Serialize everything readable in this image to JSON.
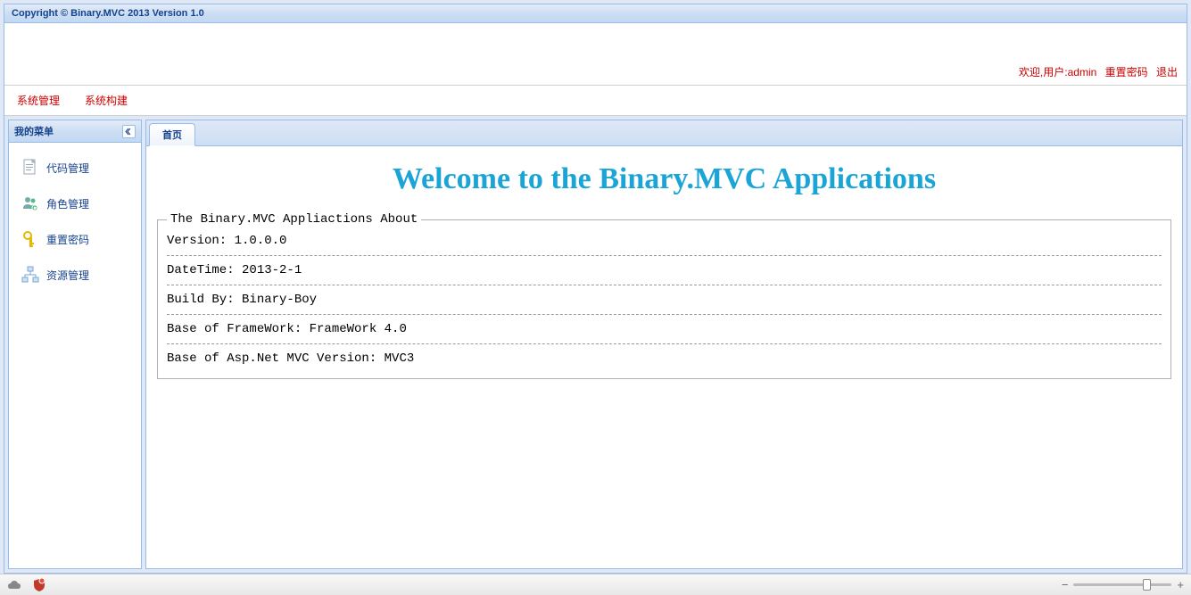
{
  "window": {
    "title": "Copyright © Binary.MVC 2013 Version 1.0"
  },
  "header": {
    "welcome_prefix": "欢迎,用户:",
    "username": "admin",
    "reset_password": "重置密码",
    "logout": "退出"
  },
  "menubar": {
    "items": [
      "系统管理",
      "系统构建"
    ]
  },
  "sidebar": {
    "title": "我的菜单",
    "items": [
      {
        "label": "代码管理",
        "icon": "document-icon"
      },
      {
        "label": "角色管理",
        "icon": "users-icon"
      },
      {
        "label": "重置密码",
        "icon": "key-icon"
      },
      {
        "label": "资源管理",
        "icon": "tree-icon"
      }
    ]
  },
  "main": {
    "tabs": [
      {
        "label": "首页"
      }
    ],
    "welcome_heading": "Welcome to the Binary.MVC Applications",
    "about": {
      "legend": "The Binary.MVC Appliactions About",
      "rows": [
        "Version: 1.0.0.0",
        "DateTime: 2013-2-1",
        "Build By: Binary-Boy",
        "Base of FrameWork: FrameWork 4.0",
        "Base of Asp.Net MVC Version: MVC3"
      ]
    }
  }
}
